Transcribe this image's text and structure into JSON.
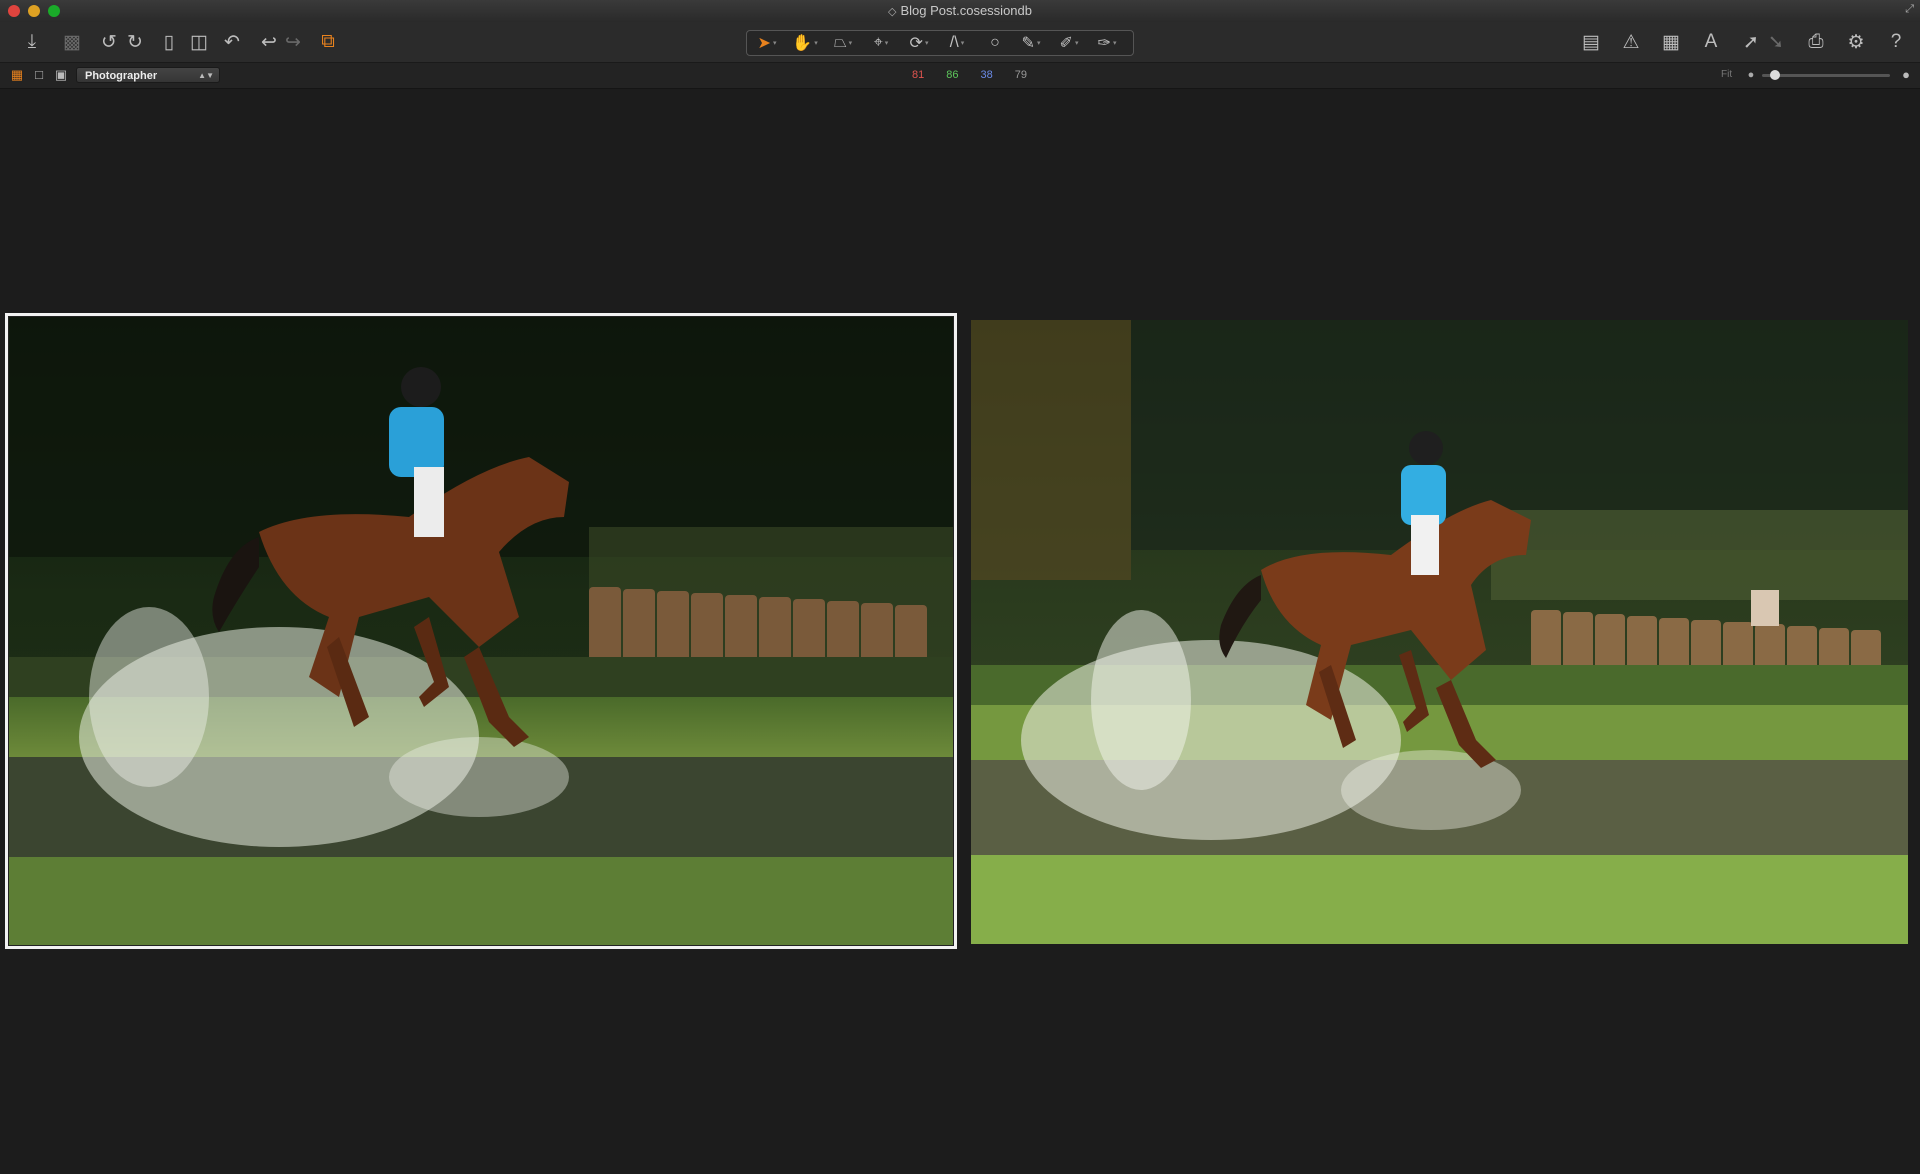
{
  "window": {
    "title": "Blog Post.cosessiondb",
    "controls": [
      "close",
      "minimize",
      "zoom"
    ]
  },
  "toolbar": {
    "left_icons": [
      "import-icon",
      "camera-icon",
      "rotate-left-icon",
      "rotate-right-icon",
      "move-to-folder-icon",
      "trash-icon",
      "reset-adjustments-icon",
      "undo-icon",
      "redo-icon",
      "variants-icon"
    ],
    "cursor_tools": [
      "select-cursor",
      "pan-cursor",
      "keystone-cursor",
      "crop-cursor",
      "rotate-cursor",
      "straighten-cursor",
      "spot-removal-cursor",
      "brush-cursor",
      "eraser-cursor",
      "picker-cursor"
    ],
    "right_icons": [
      "layout-icon",
      "exposure-warning-icon",
      "grid-icon",
      "text-overlay-icon",
      "copy-adjustments-icon",
      "apply-adjustments-icon",
      "print-icon",
      "settings-icon",
      "help-icon"
    ]
  },
  "viewbar": {
    "workspace": "Photographer",
    "rgb": {
      "r": "81",
      "g": "86",
      "b": "38",
      "l": "79"
    },
    "fit_label": "Fit",
    "colors": {
      "r": "#e0544f",
      "g": "#5dc65b",
      "b": "#6b8be8",
      "l": "#9a9a9a"
    }
  },
  "viewer": {
    "photos": [
      {
        "name": "left-variant",
        "selected": true
      },
      {
        "name": "right-variant",
        "selected": false
      }
    ]
  }
}
